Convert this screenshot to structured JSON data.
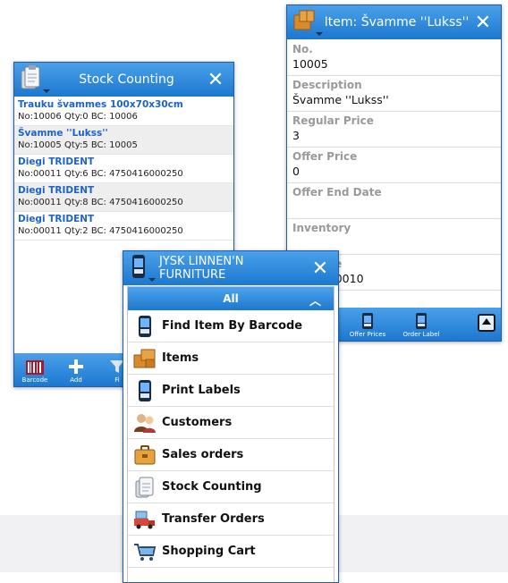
{
  "stock_window": {
    "title": "Stock Counting",
    "items": [
      {
        "name": "Trauku švammes 100x70x30cm",
        "info": "No:10006 Qty:0 BC: 10006"
      },
      {
        "name": "Švamme ''Lukss''",
        "info": "No:10005 Qty:5 BC: 10005"
      },
      {
        "name": "Diegi TRIDENT",
        "info": "No:00011 Qty:6 BC: 4750416000250"
      },
      {
        "name": "Diegi TRIDENT",
        "info": "No:00011 Qty:8 BC: 4750416000250"
      },
      {
        "name": "Diegi TRIDENT",
        "info": "No:00011 Qty:2 BC: 4750416000250"
      }
    ],
    "toolbar": [
      {
        "label": "Barcode",
        "icon": "barcode-icon"
      },
      {
        "label": "Add",
        "icon": "plus-icon"
      },
      {
        "label": "Fi",
        "icon": "filter-icon"
      }
    ]
  },
  "item_window": {
    "title": "Item: Švamme ''Lukss''",
    "fields": [
      {
        "label": "No.",
        "value": "10005"
      },
      {
        "label": "Description",
        "value": "Švamme ''Lukss''"
      },
      {
        "label": "Regular Price",
        "value": "3"
      },
      {
        "label": "Offer Price",
        "value": "0"
      },
      {
        "label": "Offer End Date",
        "value": ""
      },
      {
        "label": "Inventory",
        "value": ""
      },
      {
        "label": "Barcode",
        "value": "4751720010"
      }
    ],
    "toolbar": [
      {
        "label": "Offer Prices",
        "icon": "barcode-scanner-icon"
      },
      {
        "label": "Order Label",
        "icon": "barcode-scanner-icon"
      }
    ]
  },
  "menu_window": {
    "title": "JYSK LINNEN'N FURNITURE",
    "section": "All",
    "items": [
      {
        "label": "Find Item By Barcode",
        "icon": "barcode-scanner-icon"
      },
      {
        "label": "Items",
        "icon": "boxes-icon"
      },
      {
        "label": "Print Labels",
        "icon": "barcode-scanner-icon"
      },
      {
        "label": "Customers",
        "icon": "people-icon"
      },
      {
        "label": "Sales orders",
        "icon": "briefcase-icon"
      },
      {
        "label": "Stock Counting",
        "icon": "clipboard-icon"
      },
      {
        "label": "Transfer Orders",
        "icon": "truck-icon"
      },
      {
        "label": "Shopping Cart",
        "icon": "shopping-cart-icon"
      }
    ]
  },
  "colors": {
    "accent": "#1c78cf",
    "link": "#1e63c7",
    "muted_label": "#9a9a9a"
  }
}
